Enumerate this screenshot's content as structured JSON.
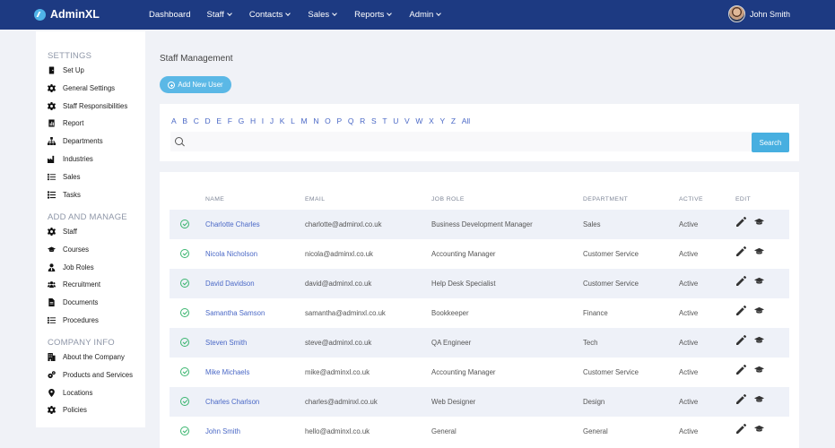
{
  "brand": {
    "name": "AdminXL"
  },
  "nav": {
    "items": [
      {
        "label": "Dashboard",
        "dropdown": false
      },
      {
        "label": "Staff",
        "dropdown": true
      },
      {
        "label": "Contacts",
        "dropdown": true
      },
      {
        "label": "Sales",
        "dropdown": true
      },
      {
        "label": "Reports",
        "dropdown": true
      },
      {
        "label": "Admin",
        "dropdown": true
      }
    ],
    "user_name": "John Smith"
  },
  "sidebar": {
    "settings_heading": "SETTINGS",
    "settings": [
      {
        "label": "Set Up",
        "icon": "door-icon"
      },
      {
        "label": "General Settings",
        "icon": "gear-icon"
      },
      {
        "label": "Staff Responsibilities",
        "icon": "gear-icon"
      },
      {
        "label": "Report",
        "icon": "chart-icon"
      },
      {
        "label": "Departments",
        "icon": "org-icon"
      },
      {
        "label": "Industries",
        "icon": "industry-icon"
      },
      {
        "label": "Sales",
        "icon": "list-icon"
      },
      {
        "label": "Tasks",
        "icon": "tasks-icon"
      }
    ],
    "manage_heading": "ADD AND MANAGE",
    "manage": [
      {
        "label": "Staff",
        "icon": "gear-icon"
      },
      {
        "label": "Courses",
        "icon": "graduation-cap-icon"
      },
      {
        "label": "Job Roles",
        "icon": "user-tie-icon"
      },
      {
        "label": "Recruitment",
        "icon": "users-icon"
      },
      {
        "label": "Documents",
        "icon": "document-icon"
      },
      {
        "label": "Procedures",
        "icon": "list-icon"
      }
    ],
    "company_heading": "COMPANY INFO",
    "company": [
      {
        "label": "About the Company",
        "icon": "building-icon"
      },
      {
        "label": "Products and Services",
        "icon": "gears-icon"
      },
      {
        "label": "Locations",
        "icon": "map-marker-icon"
      },
      {
        "label": "Policies",
        "icon": "gear-icon"
      }
    ]
  },
  "main": {
    "title": "Staff Management",
    "add_button": "Add New User",
    "alphabet": [
      "A",
      "B",
      "C",
      "D",
      "E",
      "F",
      "G",
      "H",
      "I",
      "J",
      "K",
      "L",
      "M",
      "N",
      "O",
      "P",
      "Q",
      "R",
      "S",
      "T",
      "U",
      "V",
      "W",
      "X",
      "Y",
      "Z",
      "All"
    ],
    "search_placeholder": "",
    "search_button": "Search",
    "accent": "#4a68c6",
    "status_color": "#39b56e"
  },
  "table": {
    "headers": [
      "NAME",
      "EMAIL",
      "JOB ROLE",
      "DEPARTMENT",
      "ACTIVE",
      "EDIT"
    ],
    "rows": [
      {
        "name": "Charlotte Charles",
        "email": "charlotte@adminxl.co.uk",
        "role": "Business Development Manager",
        "department": "Sales",
        "active": "Active"
      },
      {
        "name": "Nicola Nicholson",
        "email": "nicola@adminxl.co.uk",
        "role": "Accounting Manager",
        "department": "Customer Service",
        "active": "Active"
      },
      {
        "name": "David Davidson",
        "email": "david@adminxl.co.uk",
        "role": "Help Desk Specialist",
        "department": "Customer Service",
        "active": "Active"
      },
      {
        "name": "Samantha Samson",
        "email": "samantha@adminxl.co.uk",
        "role": "Bookkeeper",
        "department": "Finance",
        "active": "Active"
      },
      {
        "name": "Steven Smith",
        "email": "steve@adminxl.co.uk",
        "role": "QA Engineer",
        "department": "Tech",
        "active": "Active"
      },
      {
        "name": "Mike Michaels",
        "email": "mike@adminxl.co.uk",
        "role": "Accounting Manager",
        "department": "Customer Service",
        "active": "Active"
      },
      {
        "name": "Charles Charlson",
        "email": "charles@adminxl.co.uk",
        "role": "Web Designer",
        "department": "Design",
        "active": "Active"
      },
      {
        "name": "John Smith",
        "email": "hello@adminxl.co.uk",
        "role": "General",
        "department": "General",
        "active": "Active"
      }
    ]
  }
}
